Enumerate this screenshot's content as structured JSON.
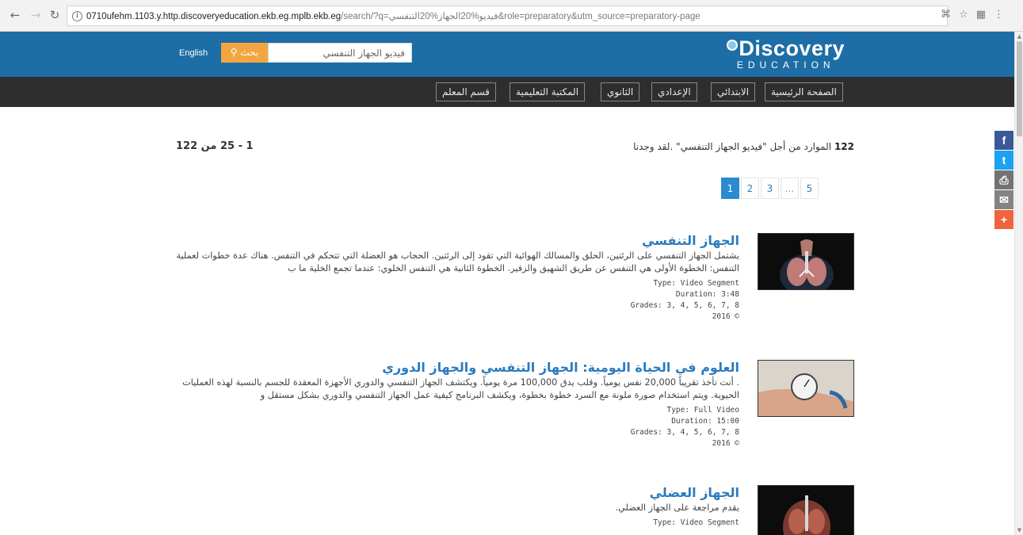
{
  "browser": {
    "url_host": "0710ufehm.1103.y.http.discoveryeducation.ekb.eg.mplb.ekb.eg",
    "url_rest": "/search/?q=فيديو%20الجهاز%20التنفسي&role=preparatory&utm_source=preparatory-page"
  },
  "header": {
    "logo_main": "Discovery",
    "logo_sub": "EDUCATION",
    "search_value": "فيديو الجهاز التنفسي",
    "search_button": "بحث",
    "language_link": "English"
  },
  "nav": {
    "items": [
      "الصفحة الرئيسية",
      "الابتدائي",
      "الإعدادي",
      "الثانوي",
      "المكتبة التعليمية",
      "قسم المعلم"
    ]
  },
  "results": {
    "range": "1 - 25 من 122",
    "count": "122",
    "summary_text": "الموارد من أجل \"فيديو الجهاز التنفسي\" .لقد وجدنا",
    "pages": [
      "1",
      "2",
      "3",
      "...",
      "5"
    ],
    "items": [
      {
        "title": "الجهاز التنفسي",
        "description": "يشتمل الجهاز التنفسي على الرئتين، الحلق والمسالك الهوائية التي تقود إلى الرئتين. الحجاب هو العضلة التي تتحكم في التنفس. هناك عدة خطوات لعملية التنفس: الخطوة الأولى هي التنفس عن طريق الشهيق والزفير. الخطوة الثانية هي التنفس الخلوي: عندما تجمع الخلية ما ب",
        "type": "Type: Video Segment",
        "duration": "Duration: 3:48",
        "grades": "Grades: 3, 4, 5, 6, 7, 8",
        "year": "2016 ©"
      },
      {
        "title": "العلوم في الحياة اليومية: الجهاز التنفسي والجهاز الدوري",
        "description": ". أنت تأخذ تقريباً 20,000 نفس يومياً. وقلب يدق 100,000 مرة يومياً. ويكتشف الجهاز التنفسي والدوري الأجهزة المعقدة للجسم بالنسبة لهذه العمليات الحيوية. ويتم استخدام صورة ملونة مع السرد خطوة بخطوة، ويكشف البرنامج كيفية عمل الجهاز التنفسي والدوري بشكل مستقل و",
        "type": "Type: Full Video",
        "duration": "Duration: 15:00",
        "grades": "Grades: 3, 4, 5, 6, 7, 8",
        "year": "2016 ©"
      },
      {
        "title": "الجهاز العضلي",
        "description": "يقدم مراجعة على الجهاز العضلي.",
        "type": "Type: Video Segment"
      }
    ]
  },
  "share": {
    "facebook": "f",
    "twitter": "t",
    "print": "⎙",
    "email": "✉",
    "more": "+"
  }
}
